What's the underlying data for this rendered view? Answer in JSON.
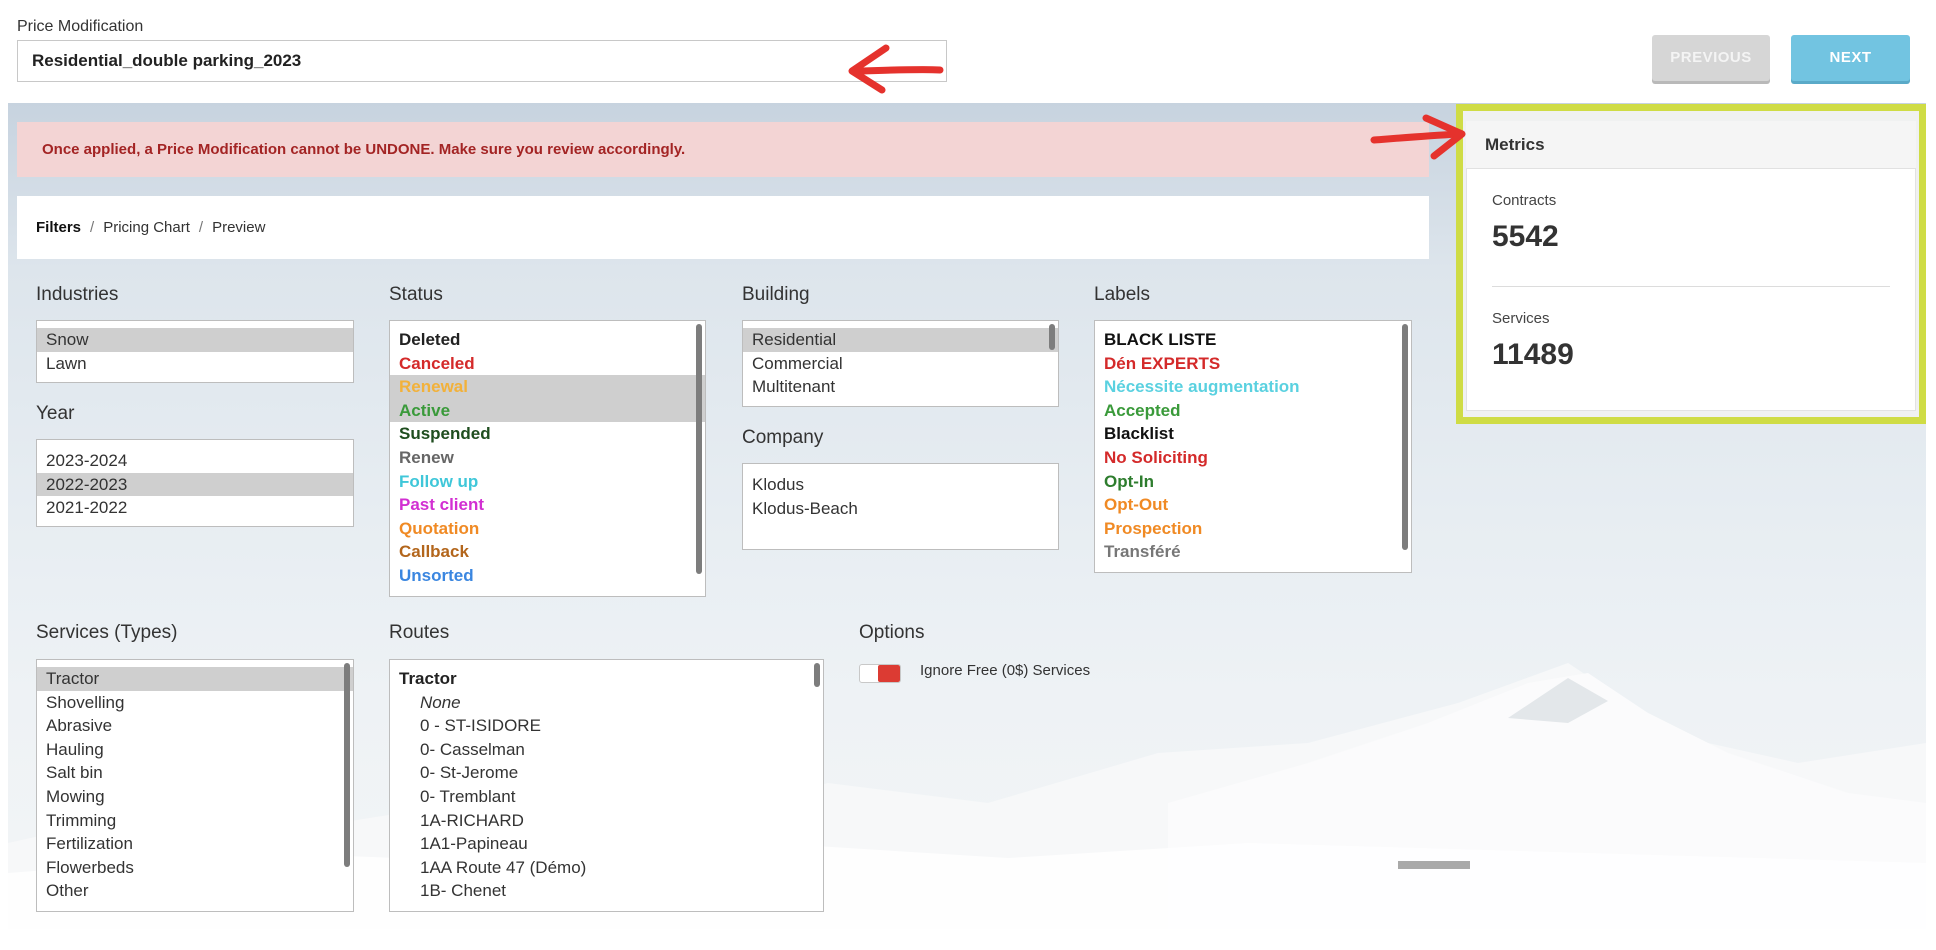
{
  "header": {
    "price_mod_label": "Price Modification",
    "price_mod_value": "Residential_double parking_2023",
    "previous_label": "PREVIOUS",
    "next_label": "NEXT"
  },
  "warning": "Once applied, a Price Modification cannot be UNDONE. Make sure you review accordingly.",
  "breadcrumb": [
    "Filters",
    "Pricing Chart",
    "Preview"
  ],
  "industries": {
    "title": "Industries",
    "options": [
      "Snow",
      "Lawn"
    ],
    "selected": [
      "Snow"
    ]
  },
  "year": {
    "title": "Year",
    "options": [
      "2023-2024",
      "2022-2023",
      "2021-2022"
    ],
    "selected": [
      "2022-2023"
    ]
  },
  "status": {
    "title": "Status",
    "options": [
      {
        "label": "Deleted",
        "color": "#222222"
      },
      {
        "label": "Canceled",
        "color": "#d42a2a"
      },
      {
        "label": "Renewal",
        "color": "#f2b13a"
      },
      {
        "label": "Active",
        "color": "#3a9a3a"
      },
      {
        "label": "Suspended",
        "color": "#1f4d1f"
      },
      {
        "label": "Renew",
        "color": "#666666"
      },
      {
        "label": "Follow up",
        "color": "#3fc7d9"
      },
      {
        "label": "Past client",
        "color": "#d22fd2"
      },
      {
        "label": "Quotation",
        "color": "#f08a24"
      },
      {
        "label": "Callback",
        "color": "#b3661c"
      },
      {
        "label": "Unsorted",
        "color": "#3a86e0"
      }
    ],
    "selected": [
      "Renewal",
      "Active"
    ]
  },
  "building": {
    "title": "Building",
    "options": [
      "Residential",
      "Commercial",
      "Multitenant"
    ],
    "selected": [
      "Residential"
    ]
  },
  "company": {
    "title": "Company",
    "options": [
      "Klodus",
      "Klodus-Beach"
    ],
    "selected": []
  },
  "labels": {
    "title": "Labels",
    "options": [
      {
        "label": "BLACK LISTE",
        "color": "#111111"
      },
      {
        "label": "Dén EXPERTS",
        "color": "#d42a2a"
      },
      {
        "label": "Nécessite augmentation",
        "color": "#5ad1e0"
      },
      {
        "label": "Accepted",
        "color": "#3a9a3a"
      },
      {
        "label": "Blacklist",
        "color": "#111111"
      },
      {
        "label": "No Soliciting",
        "color": "#d42a2a"
      },
      {
        "label": "Opt-In",
        "color": "#2e7d2e"
      },
      {
        "label": "Opt-Out",
        "color": "#f08a24"
      },
      {
        "label": "Prospection",
        "color": "#f08a24"
      },
      {
        "label": "Transféré",
        "color": "#777777"
      }
    ]
  },
  "services": {
    "title": "Services (Types)",
    "options": [
      "Tractor",
      "Shovelling",
      "Abrasive",
      "Hauling",
      "Salt bin",
      "Mowing",
      "Trimming",
      "Fertilization",
      "Flowerbeds",
      "Other"
    ],
    "selected": [
      "Tractor"
    ]
  },
  "routes": {
    "title": "Routes",
    "group": "Tractor",
    "options": [
      "None",
      "0 - ST-ISIDORE",
      "0- Casselman",
      "0- St-Jerome",
      "0- Tremblant",
      "1A-RICHARD",
      "1A1-Papineau",
      "1AA Route 47 (Démo)",
      "1B- Chenet"
    ]
  },
  "options": {
    "title": "Options",
    "ignore_free_label": "Ignore Free (0$) Services",
    "ignore_free_on": true
  },
  "metrics": {
    "title": "Metrics",
    "contracts_label": "Contracts",
    "contracts_value": "5542",
    "services_label": "Services",
    "services_value": "11489"
  },
  "colors": {
    "annotation_arrow": "#e5322d",
    "highlight_frame": "#cfdc45",
    "next_button": "#72c4e1"
  }
}
